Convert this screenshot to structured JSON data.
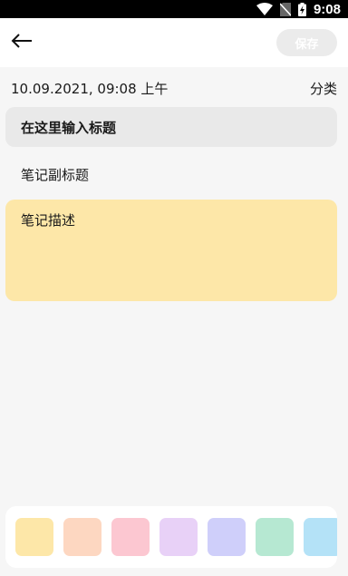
{
  "status_bar": {
    "time": "9:08",
    "icons": [
      "wifi-icon",
      "no-sim-icon",
      "battery-charging-icon"
    ]
  },
  "toolbar": {
    "back_icon": "arrow-left-icon",
    "save_label": "保存"
  },
  "note": {
    "datetime": "10.09.2021, 09:08 上午",
    "category_label": "分类",
    "title_placeholder": "在这里输入标题",
    "subtitle_placeholder": "笔记副标题",
    "description_placeholder": "笔记描述"
  },
  "palette": {
    "colors": [
      "#fde7a8",
      "#fdd7c1",
      "#fcc7d1",
      "#e8d1f7",
      "#cfcffa",
      "#b6e8d2",
      "#b4e2f7"
    ]
  }
}
